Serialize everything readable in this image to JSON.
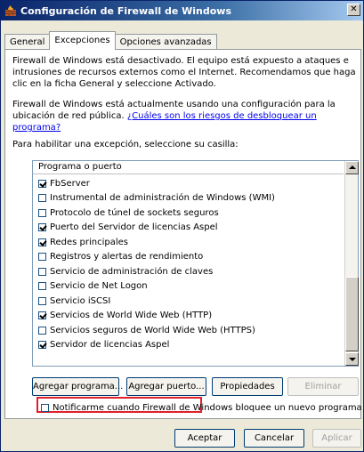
{
  "window": {
    "title": "Configuración de Firewall de Windows",
    "close_glyph": "✕"
  },
  "tabs": [
    {
      "label": "General",
      "active": false
    },
    {
      "label": "Excepciones",
      "active": true
    },
    {
      "label": "Opciones avanzadas",
      "active": false
    }
  ],
  "content": {
    "intro_text": "Firewall de Windows está desactivado. El equipo está expuesto a ataques e intrusiones de recursos externos como el Internet. Recomendamos que haga clic en la ficha General y seleccione Activado.",
    "status_text": "Firewall de Windows está actualmente usando una configuración para la ubicación de red pública.",
    "risk_link": "¿Cuáles son los riesgos de desbloquear un programa?",
    "instruction_text": "Para habilitar una excepción, seleccione su casilla:"
  },
  "list": {
    "header": "Programa o puerto",
    "items": [
      {
        "label": "FbServer",
        "checked": true
      },
      {
        "label": "Instrumental de administración de Windows (WMI)",
        "checked": false
      },
      {
        "label": "Protocolo de túnel de sockets seguros",
        "checked": false
      },
      {
        "label": "Puerto del Servidor de licencias Aspel",
        "checked": true
      },
      {
        "label": "Redes principales",
        "checked": true
      },
      {
        "label": "Registros y alertas de rendimiento",
        "checked": false
      },
      {
        "label": "Servicio de administración de claves",
        "checked": false
      },
      {
        "label": "Servicio de Net Logon",
        "checked": false
      },
      {
        "label": "Servicio iSCSI",
        "checked": false
      },
      {
        "label": "Servicios de World Wide Web (HTTP)",
        "checked": true
      },
      {
        "label": "Servicios seguros de World Wide Web (HTTPS)",
        "checked": false
      },
      {
        "label": "Servidor de licencias Aspel",
        "checked": true
      }
    ]
  },
  "buttons": {
    "add_program": "Agregar programa...",
    "add_port": "Agregar puerto...",
    "properties": "Propiedades",
    "delete": "Eliminar",
    "ok": "Aceptar",
    "cancel": "Cancelar",
    "apply": "Aplicar"
  },
  "notify": {
    "label": "Notificarme cuando Firewall de Windows bloquee un nuevo programa",
    "checked": false
  },
  "colors": {
    "highlight": "#e0202a",
    "link": "#0000ee",
    "title_bar": "#0a246a"
  }
}
